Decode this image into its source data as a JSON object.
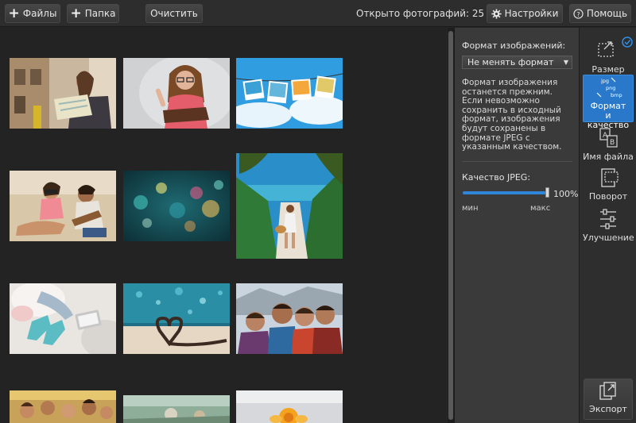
{
  "toolbar": {
    "files_label": "Файлы",
    "folder_label": "Папка",
    "clear_label": "Очистить",
    "count_text": "Открыто фотографий: 25",
    "settings_label": "Настройки",
    "help_label": "Помощь"
  },
  "gallery": {
    "photos": [
      "woman-with-map",
      "woman-with-book",
      "photos-on-clothesline",
      "couple-on-beach",
      "bokeh-lights",
      "woman-on-tropical-path",
      "feet-in-socks-on-bed",
      "film-heart-bokeh",
      "friends-selfie",
      "group-of-friends",
      "outdoor-scene",
      "flowers"
    ]
  },
  "panel": {
    "format_label": "Формат изображений:",
    "format_value": "Не менять формат",
    "description": "Формат изображения останется прежним. Если невозможно сохранить в исходный формат, изображения будут сохранены в формате JPEG с указанным качеством.",
    "quality_label": "Качество JPEG:",
    "quality_value": "100%",
    "quality_level": 1.0,
    "min_label": "мин",
    "max_label": "макс"
  },
  "tools": {
    "resize": "Размер",
    "format_line1": "Формат",
    "format_line2": "и качество",
    "format_icon_text": "jpg\npng\nbmp",
    "filename": "Имя файла",
    "rotate": "Поворот",
    "enhance": "Улучшение",
    "export": "Экспорт"
  },
  "colors": {
    "accent": "#2a78c9",
    "background": "#232323",
    "panel": "#3a3a3a"
  }
}
